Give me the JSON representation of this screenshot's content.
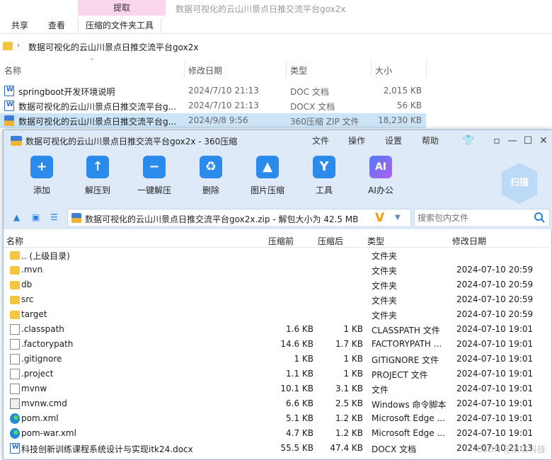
{
  "explorer": {
    "ribbon": {
      "context_tab": "提取",
      "title": "数据可视化的云山川景点日推交流平台gox2x",
      "tabs": [
        "共享",
        "查看",
        "压缩的文件夹工具"
      ]
    },
    "address": "数据可视化的云山川景点日推交流平台gox2x",
    "columns": {
      "name": "名称",
      "modified": "修改日期",
      "type": "类型",
      "size": "大小"
    },
    "files": [
      {
        "name": "springboot开发环境说明",
        "date": "2024/7/10 21:13",
        "type": "DOC 文档",
        "size": "2,015 KB",
        "icon": "word-doc-icon"
      },
      {
        "name": "数据可视化的云山川景点日推交流平台g...",
        "date": "2024/7/10 21:13",
        "type": "DOCX 文档",
        "size": "56 KB",
        "icon": "word-doc-icon"
      },
      {
        "name": "数据可视化的云山川景点日推交流平台g...",
        "date": "2024/9/8 9:56",
        "type": "360压缩 ZIP 文件",
        "size": "18,230 KB",
        "icon": "zip-icon"
      }
    ]
  },
  "win": {
    "title": "数据可视化的云山川景点日推交流平台gox2x - 360压缩",
    "menus": [
      "文件",
      "操作",
      "设置",
      "帮助"
    ],
    "tools": [
      {
        "label": "添加",
        "glyph": "+"
      },
      {
        "label": "解压到",
        "glyph": "↑"
      },
      {
        "label": "一键解压",
        "glyph": "−"
      },
      {
        "label": "删除",
        "glyph": "♻"
      },
      {
        "label": "图片压缩",
        "glyph": "▲"
      },
      {
        "label": "工具",
        "glyph": "Y"
      },
      {
        "label": "AI办公",
        "glyph": "AI"
      }
    ],
    "scan_label": "扫描",
    "path": "数据可视化的云山川景点日推交流平台gox2x.zip - 解包大小为 42.5 MB",
    "path_badge": "V",
    "search_placeholder": "搜索包内文件",
    "columns": {
      "name": "名称",
      "compressed": "压缩前",
      "original": "压缩后",
      "type": "类型",
      "modified": "修改日期"
    },
    "rows": [
      {
        "name": ".. (上级目录)",
        "cs": "",
        "os": "",
        "type": "文件夹",
        "date": "",
        "icon": "folder"
      },
      {
        "name": ".mvn",
        "cs": "",
        "os": "",
        "type": "文件夹",
        "date": "2024-07-10 20:59",
        "icon": "folder"
      },
      {
        "name": "db",
        "cs": "",
        "os": "",
        "type": "文件夹",
        "date": "2024-07-10 20:59",
        "icon": "folder"
      },
      {
        "name": "src",
        "cs": "",
        "os": "",
        "type": "文件夹",
        "date": "2024-07-10 20:59",
        "icon": "folder"
      },
      {
        "name": "target",
        "cs": "",
        "os": "",
        "type": "文件夹",
        "date": "2024-07-10 20:59",
        "icon": "folder"
      },
      {
        "name": ".classpath",
        "cs": "1.6 KB",
        "os": "1 KB",
        "type": "CLASSPATH 文件",
        "date": "2024-07-10 19:01",
        "icon": "file"
      },
      {
        "name": ".factorypath",
        "cs": "14.6 KB",
        "os": "1.7 KB",
        "type": "FACTORYPATH ...",
        "date": "2024-07-10 19:01",
        "icon": "file"
      },
      {
        "name": ".gitignore",
        "cs": "1 KB",
        "os": "1 KB",
        "type": "GITIGNORE 文件",
        "date": "2024-07-10 19:01",
        "icon": "file"
      },
      {
        "name": ".project",
        "cs": "1.1 KB",
        "os": "1 KB",
        "type": "PROJECT 文件",
        "date": "2024-07-10 19:01",
        "icon": "file"
      },
      {
        "name": "mvnw",
        "cs": "10.1 KB",
        "os": "3.1 KB",
        "type": "文件",
        "date": "2024-07-10 19:01",
        "icon": "file"
      },
      {
        "name": "mvnw.cmd",
        "cs": "6.6 KB",
        "os": "2.5 KB",
        "type": "Windows 命令脚本",
        "date": "2024-07-10 19:01",
        "icon": "cmd"
      },
      {
        "name": "pom.xml",
        "cs": "5.1 KB",
        "os": "1.2 KB",
        "type": "Microsoft Edge ...",
        "date": "2024-07-10 19:01",
        "icon": "edge"
      },
      {
        "name": "pom-war.xml",
        "cs": "4.7 KB",
        "os": "1.2 KB",
        "type": "Microsoft Edge ...",
        "date": "2024-07-10 19:01",
        "icon": "edge"
      },
      {
        "name": "科技创新训练课程系统设计与实现itk24.docx",
        "cs": "55.5 KB",
        "os": "47.4 KB",
        "type": "DOCX 文档",
        "date": "2024-07-10 21:13",
        "icon": "word"
      }
    ],
    "watermark": "CSDN @五亿科技"
  },
  "colors": {
    "titlebar_bg": "#dfeaf8",
    "accent": "#2a8bea",
    "context_tab": "#f9d6ec",
    "selected_row": "#cce4f7"
  }
}
